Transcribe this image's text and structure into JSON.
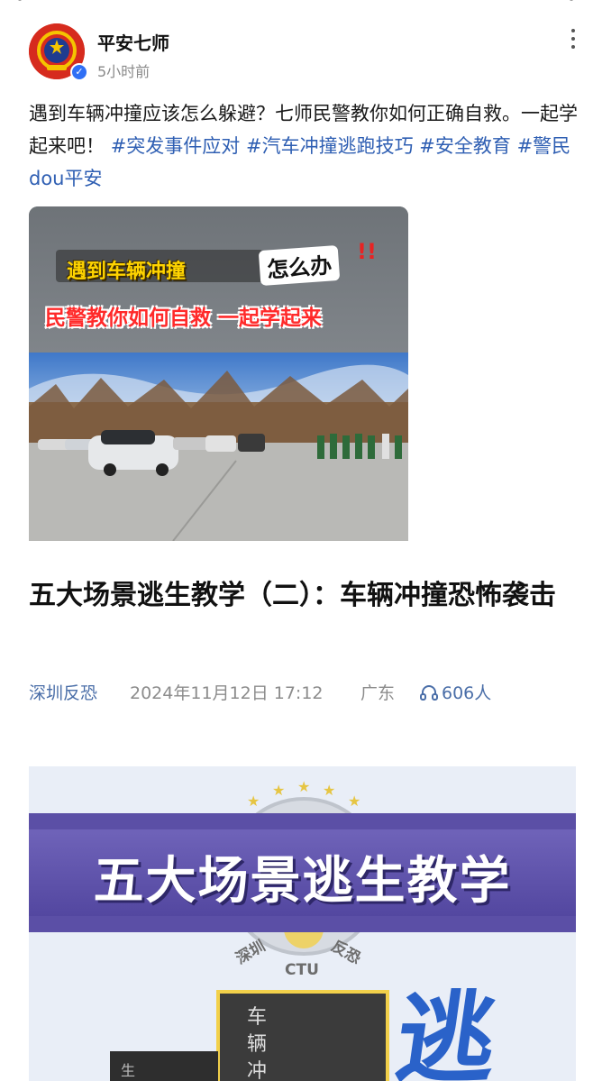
{
  "post": {
    "author": "平安七师",
    "time": "5小时前",
    "caption_text": "遇到车辆冲撞应该怎么躲避？七师民警教你如何正确自救。一起学起来吧！",
    "hashtags": [
      "#突发事件应对",
      "#汽车冲撞逃跑技巧",
      "#安全教育",
      "#警民dou平安"
    ]
  },
  "video": {
    "title_line1": "遇到车辆冲撞",
    "title_badge": "怎么办",
    "title_exclaim": "!!",
    "title_line2": "民警教你如何自救 一起学起来"
  },
  "article": {
    "title": "五大场景逃生教学（二）：车辆冲撞恐怖袭击",
    "source": "深圳反恐",
    "date": "2024年11月12日 17:12",
    "region": "广东",
    "listeners": "606人"
  },
  "poster": {
    "title": "五大场景逃生教学",
    "seal_left": "深圳",
    "seal_mid": "CTU",
    "seal_right": "反恐",
    "box_text": "车辆冲",
    "box2_text": "生",
    "brush_text": "逃"
  },
  "colors": {
    "hashtag": "#2f5fb3",
    "source_link": "#4a6ea8",
    "poster_band": "#5b4fa6",
    "verified": "#2f6ff5"
  },
  "icons": [
    "police-emblem-icon",
    "verified-icon",
    "more-vertical-icon",
    "headphones-icon"
  ]
}
